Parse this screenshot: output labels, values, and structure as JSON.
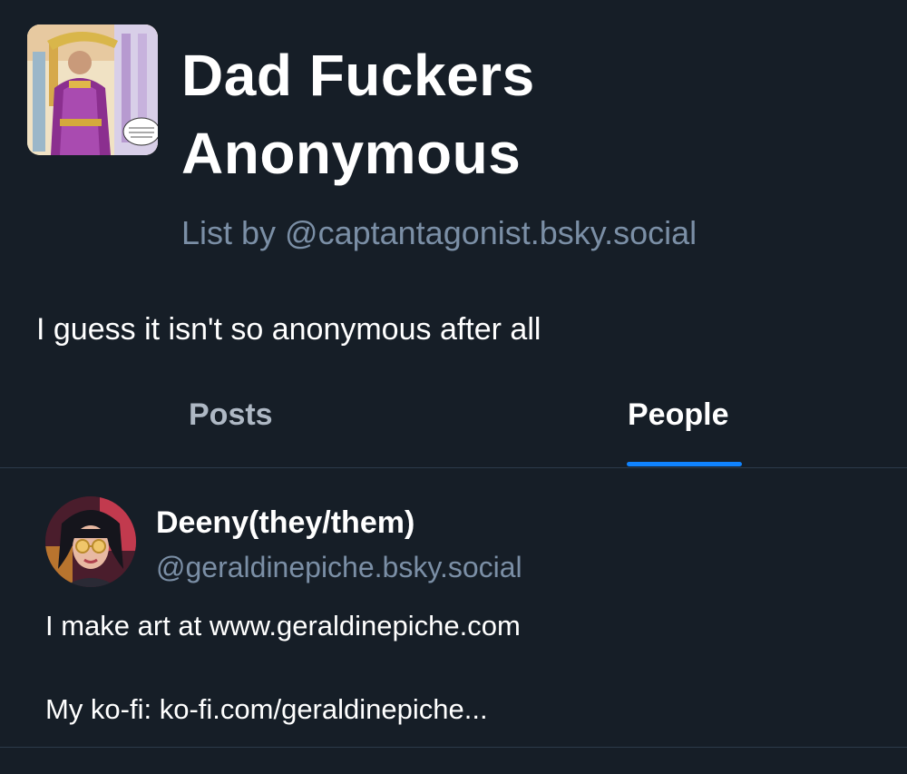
{
  "list": {
    "title_line1": "Dad Fuckers",
    "title_line2": "Anonymous",
    "byline_prefix": "List by ",
    "byline_handle": "@captantagonist.bsky.social",
    "description": "I guess it isn't so anonymous after all",
    "avatar_icon": "comic-panel-image"
  },
  "tabs": [
    {
      "label": "Posts",
      "active": false
    },
    {
      "label": "People",
      "active": true
    }
  ],
  "colors": {
    "background": "#161e27",
    "accent": "#1083fe",
    "muted_text": "#7b8fa6",
    "divider": "#2c3a4a"
  },
  "people": [
    {
      "name": "Deeny(they/them)",
      "handle": "@geraldinepiche.bsky.social",
      "bio_line1": "I make art at www.geraldinepiche.com",
      "bio_line2": "My ko-fi: ko-fi.com/geraldinepiche...",
      "avatar_icon": "user-avatar-illustration"
    }
  ]
}
